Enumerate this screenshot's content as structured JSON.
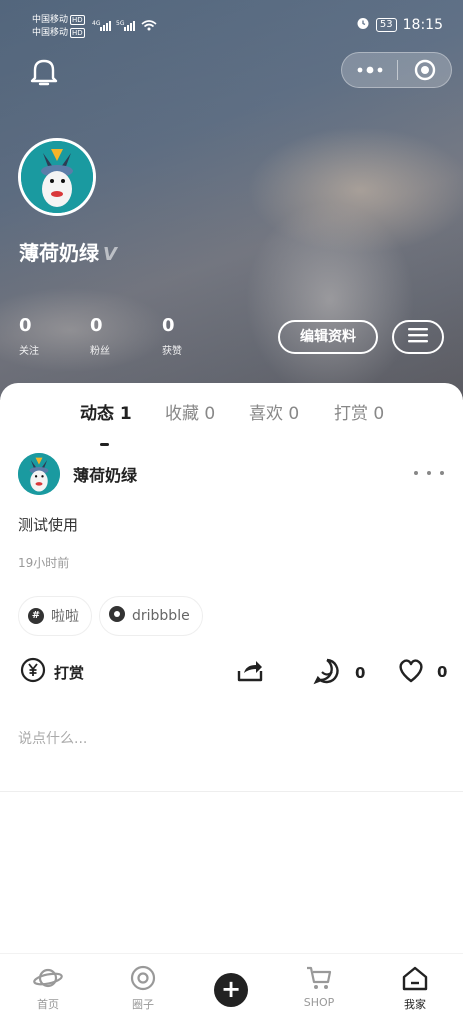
{
  "status_bar": {
    "carrier_1": "中国移动",
    "carrier_2": "中国移动",
    "hd": "HD",
    "net_1": "4G",
    "net_2": "5G",
    "battery": "53",
    "time": "18:15"
  },
  "profile": {
    "username": "薄荷奶绿",
    "verify_mark": "V",
    "stats": [
      {
        "value": "0",
        "label": "关注"
      },
      {
        "value": "0",
        "label": "粉丝"
      },
      {
        "value": "0",
        "label": "获赞"
      }
    ],
    "edit_label": "编辑资料"
  },
  "tabs": [
    {
      "label": "动态",
      "count": "1",
      "active": true
    },
    {
      "label": "收藏",
      "count": "0",
      "active": false
    },
    {
      "label": "喜欢",
      "count": "0",
      "active": false
    },
    {
      "label": "打赏",
      "count": "0",
      "active": false
    }
  ],
  "post": {
    "author": "薄荷奶绿",
    "text": "测试使用",
    "time": "19小时前",
    "tags": [
      {
        "icon": "#",
        "label": "啦啦"
      },
      {
        "icon": "●",
        "label": "dribbble"
      }
    ],
    "tip_label": "打赏",
    "comment_count": "0",
    "like_count": "0",
    "comment_placeholder": "说点什么..."
  },
  "bottom_nav": [
    {
      "label": "首页",
      "icon": "planet-icon"
    },
    {
      "label": "圈子",
      "icon": "circle-target-icon"
    },
    {
      "label": "",
      "icon": "plus-icon"
    },
    {
      "label": "SHOP",
      "icon": "cart-icon"
    },
    {
      "label": "我家",
      "icon": "home-icon"
    }
  ],
  "colors": {
    "accent": "#222222",
    "avatar_bg": "#1a9aa0",
    "muted": "#999999"
  }
}
